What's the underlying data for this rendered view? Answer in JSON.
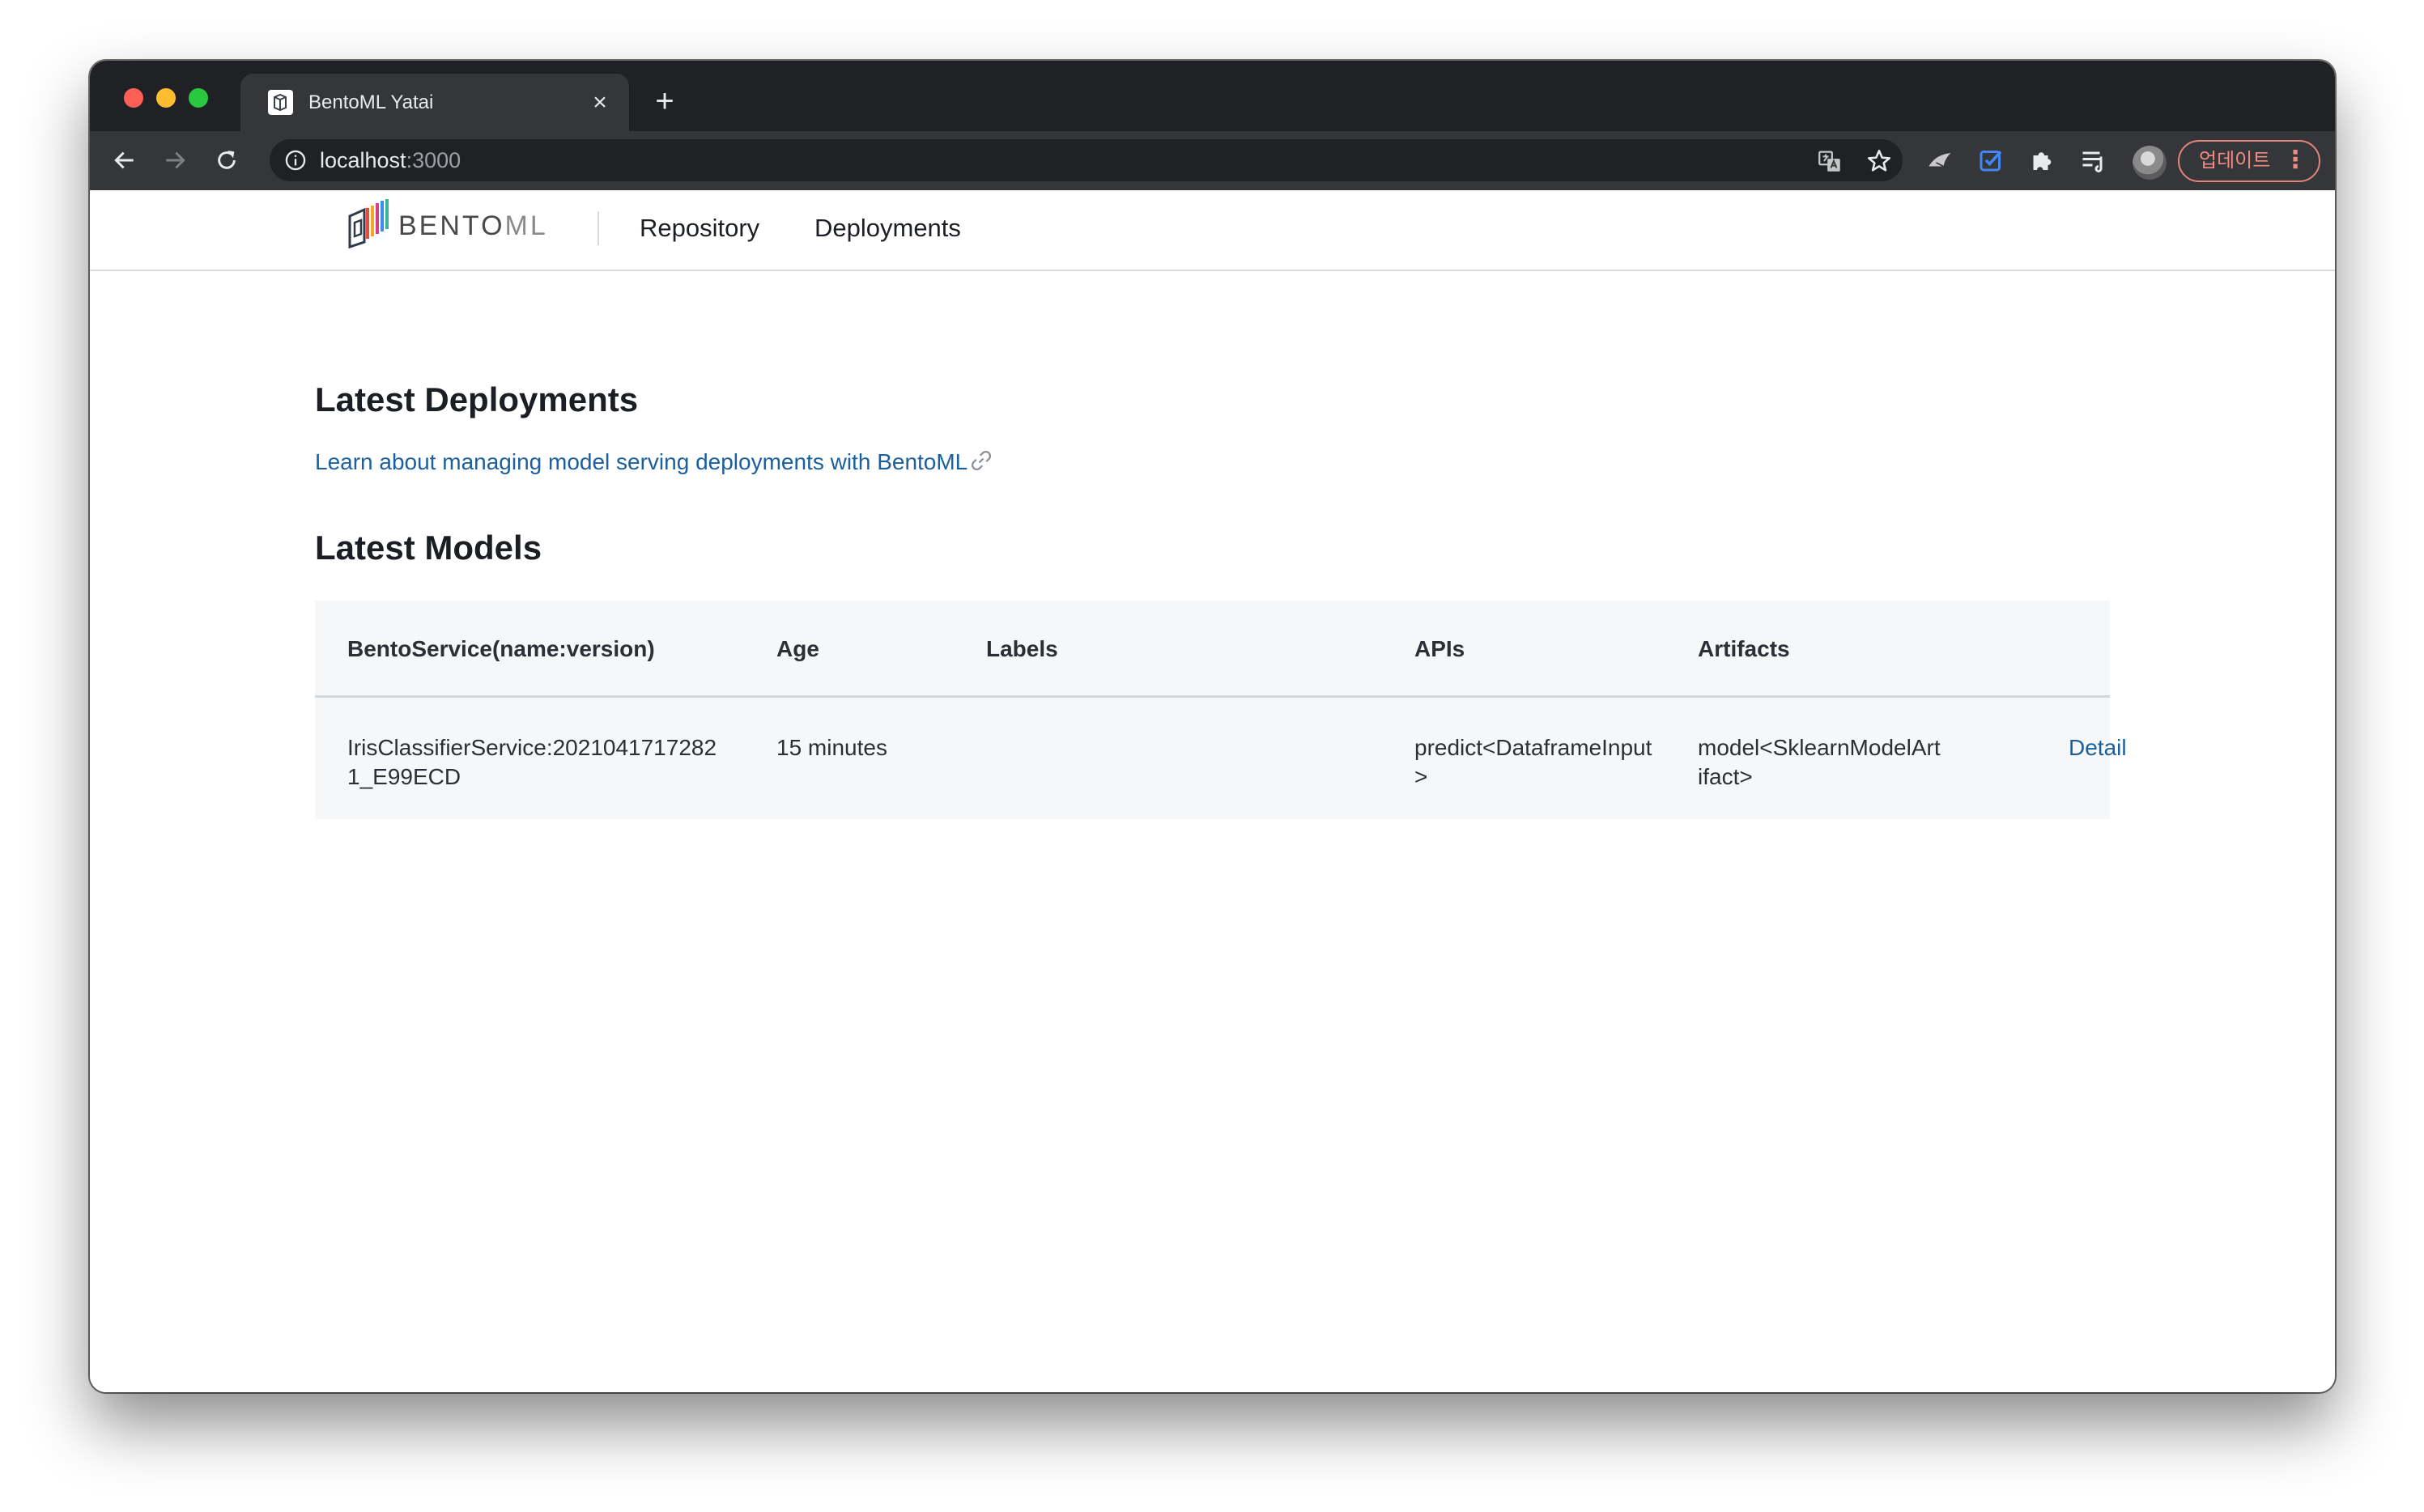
{
  "browser": {
    "tab_title": "BentoML Yatai",
    "tab_close_glyph": "×",
    "new_tab_glyph": "+",
    "url_host": "localhost",
    "url_port": ":3000",
    "update_label": "업데이트",
    "update_menu_glyph": "⋮",
    "icons": [
      "back-arrow-icon",
      "forward-arrow-icon",
      "reload-icon",
      "info-icon",
      "translate-icon",
      "star-icon",
      "bird-extension-icon",
      "checkbox-extension-icon",
      "puzzle-icon",
      "reading-list-icon"
    ],
    "colors": {
      "titlebar": "#202124",
      "toolbar": "#35363a",
      "update_accent": "#f28b82",
      "extension_blue": "#4285f4"
    }
  },
  "navbar": {
    "brand_text": "BENTO",
    "brand_text_suffix": "ML",
    "links": [
      {
        "label": "Repository"
      },
      {
        "label": "Deployments"
      }
    ]
  },
  "main": {
    "deployments_heading": "Latest Deployments",
    "deployments_link": "Learn about managing model serving deployments with BentoML",
    "models_heading": "Latest Models",
    "table": {
      "headers": [
        "BentoService(name:version)",
        "Age",
        "Labels",
        "APIs",
        "Artifacts"
      ],
      "rows": [
        {
          "service": "IrisClassifierService:20210417172821_E99ECD",
          "age": "15 minutes",
          "labels": "",
          "apis": "predict<DataframeInput>",
          "artifacts": "model<SklearnModelArtifact>",
          "action": "Detail"
        }
      ]
    },
    "colors": {
      "link": "#1a5f9e",
      "table_bg": "#f5f7f9",
      "text": "#1b1f24"
    }
  }
}
